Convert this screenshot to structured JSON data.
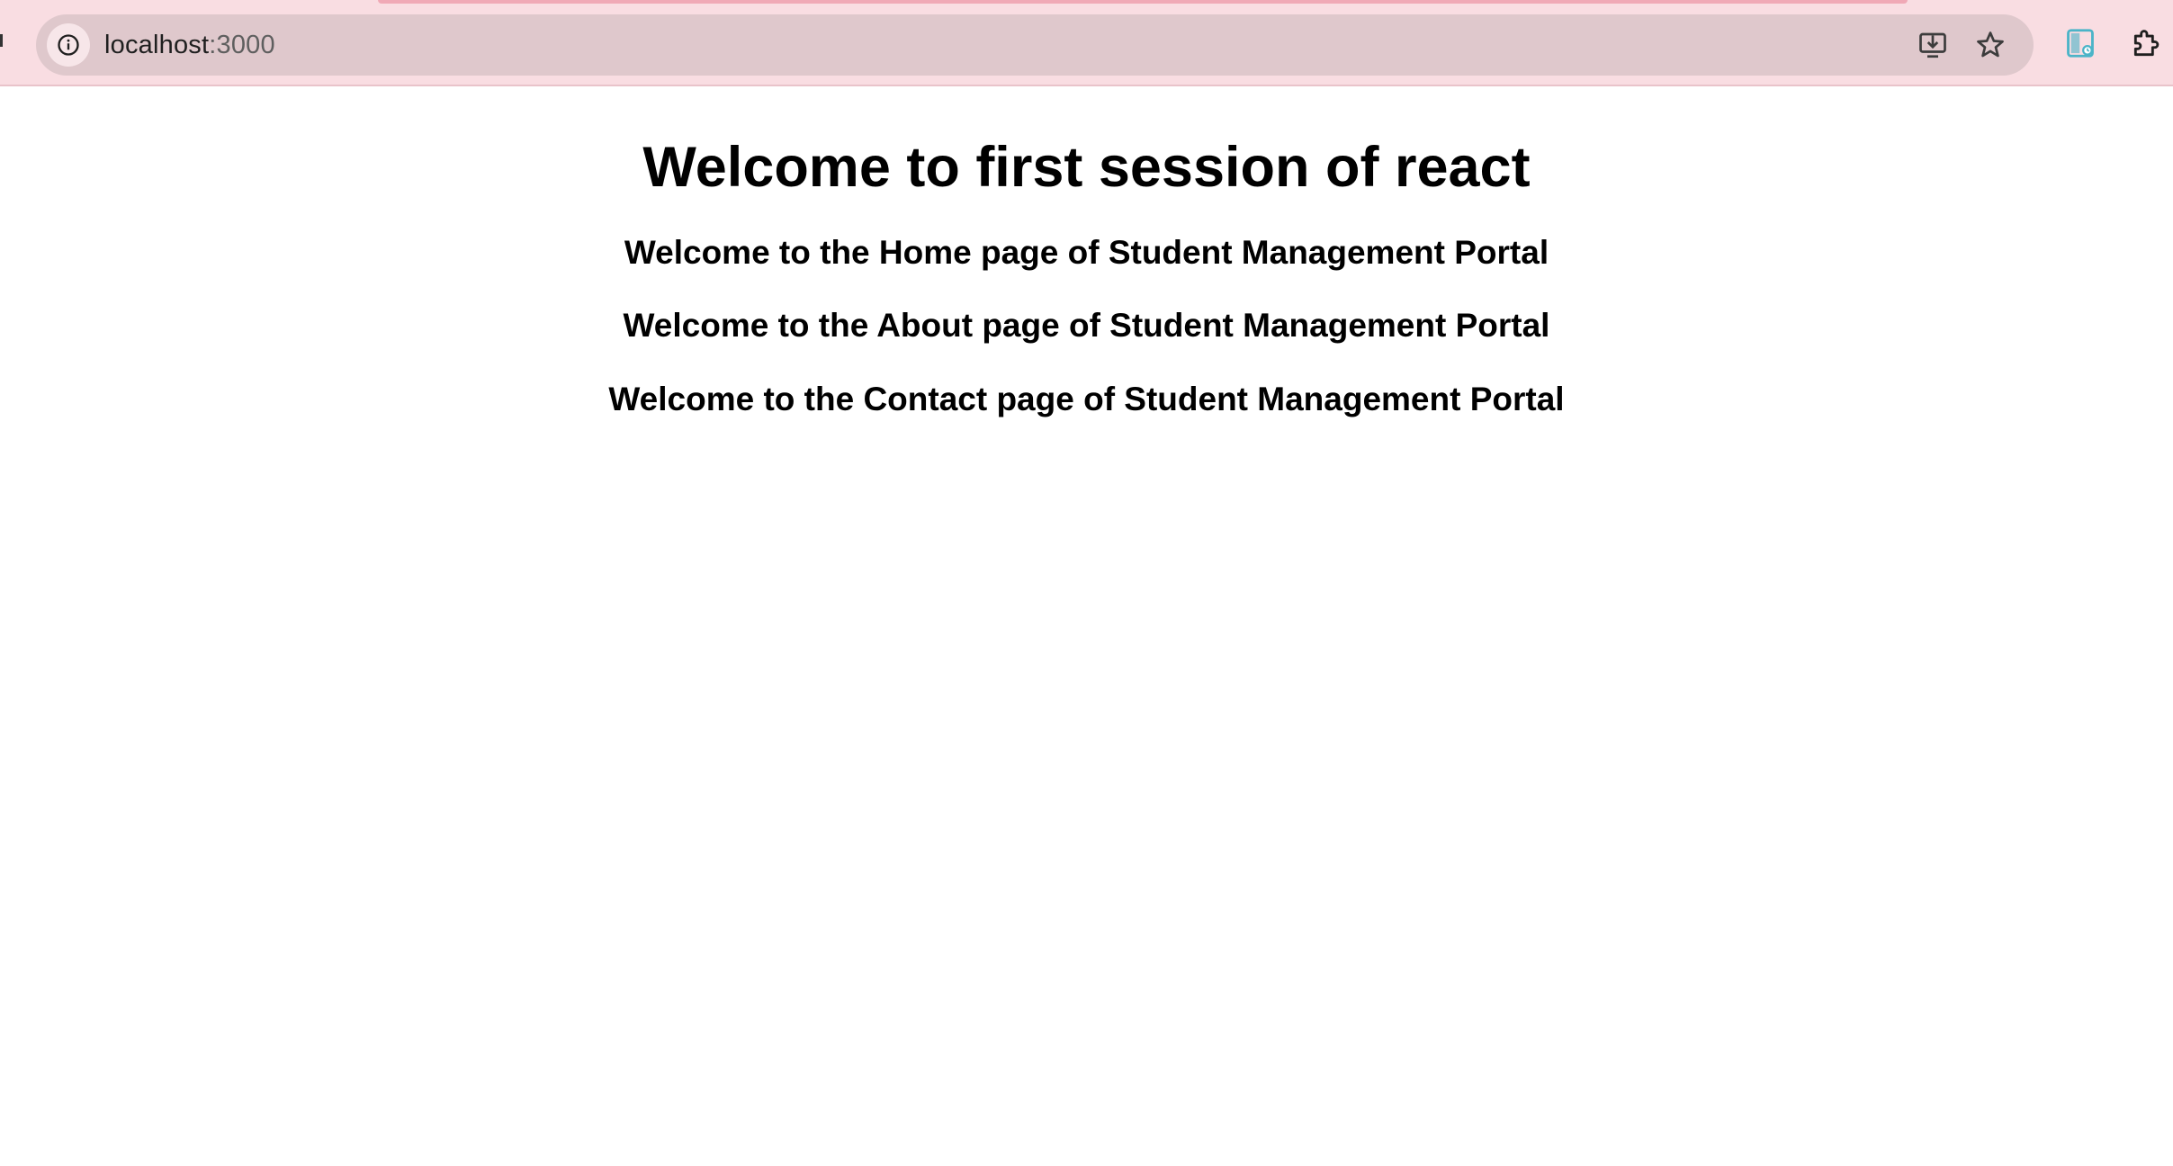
{
  "browser": {
    "url_host": "localhost",
    "url_port": ":3000",
    "icons": {
      "site_info": "info-circle-icon",
      "install": "install-app-icon",
      "bookmark": "star-icon",
      "extension_app": "side-panel-icon",
      "extensions": "puzzle-piece-icon"
    },
    "colors": {
      "frame": "#f9dde2",
      "omnibox": "#dfc8cc",
      "accent_icon": "#4bb4c8"
    }
  },
  "page": {
    "title": "Welcome to first session of react",
    "home_heading": "Welcome to the Home page of Student Management Portal",
    "about_heading": "Welcome to the About page of Student Management Portal",
    "contact_heading": "Welcome to the Contact page of Student Management Portal"
  }
}
